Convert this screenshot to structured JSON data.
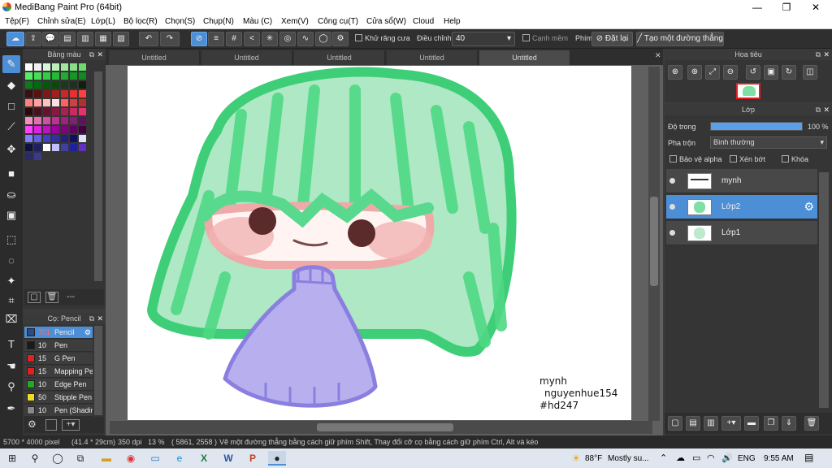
{
  "window": {
    "title": "MediBang Paint Pro (64bit)",
    "minimize": "—",
    "maximize": "❐",
    "close": "✕"
  },
  "menu": [
    "Tệp(F)",
    "Chỉnh sửa(E)",
    "Lớp(L)",
    "Bộ lọc(R)",
    "Chọn(S)",
    "Chụp(N)",
    "Màu (C)",
    "Xem(V)",
    "Công cụ(T)",
    "Cửa sổ(W)",
    "Cloud",
    "Help"
  ],
  "toolbar": {
    "antialias_label": "Khử răng cưa",
    "adjust_label": "Điều chỉnh",
    "adjust_value": "40",
    "smooth_edge_label": "Cạnh mềm",
    "key_label": "Phím",
    "reset_label": "Đặt lại",
    "straight_line_label": "Tạo một đường thẳng"
  },
  "color_panel": {
    "title": "Bảng màu"
  },
  "brush_panel": {
    "title": "Cọ: Pencil",
    "brushes": [
      {
        "size": "701",
        "name": "Pencil",
        "color": "#2a4a8a"
      },
      {
        "size": "10",
        "name": "Pen",
        "color": "#1a1a1a"
      },
      {
        "size": "15",
        "name": "G Pen",
        "color": "#dd2222"
      },
      {
        "size": "15",
        "name": "Mapping Pen",
        "color": "#dd2222"
      },
      {
        "size": "10",
        "name": "Edge Pen",
        "color": "#22aa22"
      },
      {
        "size": "50",
        "name": "Stipple Pen",
        "color": "#eedd22"
      },
      {
        "size": "10",
        "name": "Pen (Shading)",
        "color": "#888888"
      }
    ]
  },
  "tabs": [
    "Untitled",
    "Untitled",
    "Untitled",
    "Untitled",
    "Untitled"
  ],
  "canvas_text": {
    "line1": "mynh",
    "line2": "nguyenhue154",
    "line3": "#hd247"
  },
  "navigator": {
    "title": "Hoa tiêu"
  },
  "layer_panel": {
    "title": "Lớp",
    "opacity_label": "Độ trong",
    "opacity_value": "100 %",
    "opacity_fraction": 1.0,
    "blend_label": "Pha trộn",
    "blend_value": "Bình thường",
    "protect_alpha": "Bảo vệ alpha",
    "clip": "Xén bớt",
    "lock": "Khóa",
    "layers": [
      {
        "name": "mynh"
      },
      {
        "name": "Lớp2"
      },
      {
        "name": "Lớp1"
      }
    ]
  },
  "status": {
    "size": "5700 * 4000 pixel",
    "size_cm": "(41.4 * 29cm)",
    "dpi": "350 dpi",
    "zoom": "13 %",
    "coords": "( 5861, 2558 )",
    "hint": "Vẽ một đường thẳng bằng cách giữ phím Shift, Thay đổi cỡ cọ bằng cách giữ phím Ctrl, Alt và kéo"
  },
  "taskbar": {
    "weather": "88°F",
    "weather_text": "Mostly su...",
    "lang": "ENG",
    "time": "9:55 AM"
  },
  "colors": {
    "accent": "#4d8fd6",
    "panel": "#353535",
    "hair": "#3dcf7a",
    "cloak": "#b8b0ee"
  }
}
